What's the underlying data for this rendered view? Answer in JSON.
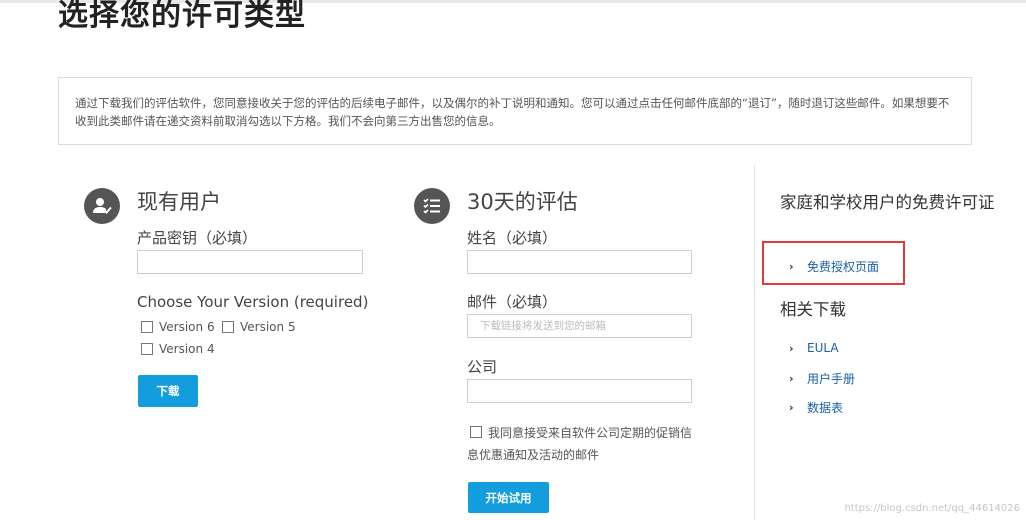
{
  "page": {
    "title": "选择您的许可类型",
    "notice": "通过下载我们的评估软件，您同意接收关于您的评估的后续电子邮件，以及偶尔的补丁说明和通知。您可以通过点击任何邮件底部的“退订”，随时退订这些邮件。如果想要不收到此类邮件请在递交资料前取消勾选以下方格。我们不会向第三方出售您的信息。"
  },
  "existing_user": {
    "icon": "user-check-icon",
    "heading": "现有用户",
    "product_key_label": "产品密钥（必填）",
    "product_key_value": "",
    "version_label": "Choose Your Version (required)",
    "versions": [
      "Version 6",
      "Version 5",
      "Version 4"
    ],
    "download_label": "下载"
  },
  "trial": {
    "icon": "checklist-icon",
    "heading": "30天的评估",
    "name_label": "姓名（必填）",
    "name_value": "",
    "email_label": "邮件（必填）",
    "email_placeholder": "下载链接将发送到您的邮箱",
    "company_label": "公司",
    "company_value": "",
    "agree_text": "我同意接受来自软件公司定期的促销信息优惠通知及活动的邮件",
    "start_label": "开始试用"
  },
  "sidebar": {
    "free_heading": "家庭和学校用户的免费许可证",
    "free_link": "免费授权页面",
    "downloads_heading": "相关下载",
    "downloads": [
      "EULA",
      "用户手册",
      "数据表"
    ]
  },
  "watermark": "https://blog.csdn.net/qq_44614026",
  "colors": {
    "accent": "#139ddd",
    "highlight": "#e23b3b",
    "link": "#1a5fa8"
  }
}
